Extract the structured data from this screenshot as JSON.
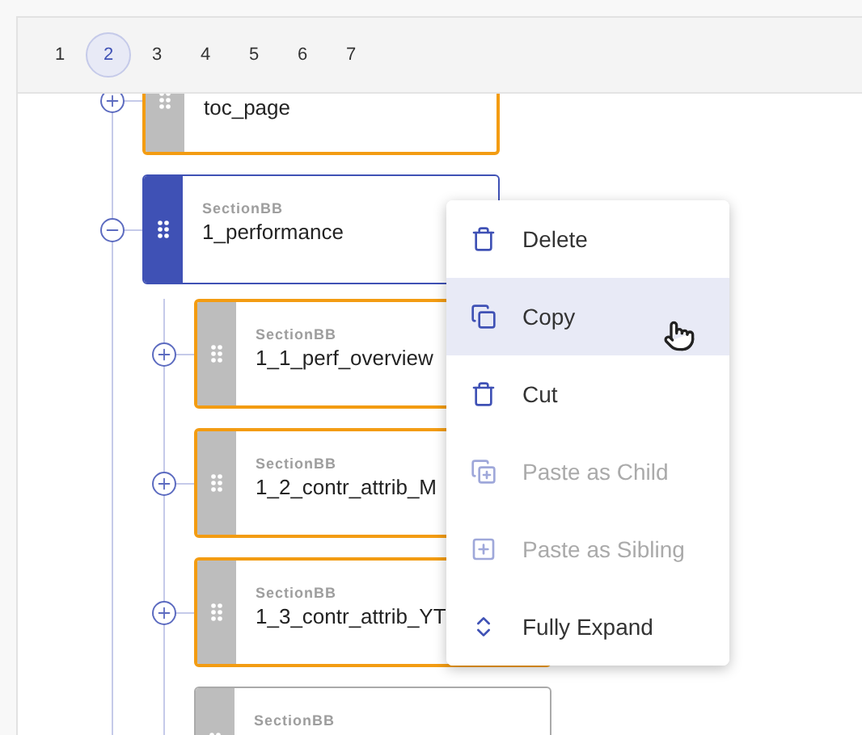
{
  "pager": [
    {
      "label": "1",
      "selected": false
    },
    {
      "label": "2",
      "selected": true
    },
    {
      "label": "3",
      "selected": false
    },
    {
      "label": "4",
      "selected": false
    },
    {
      "label": "5",
      "selected": false
    },
    {
      "label": "6",
      "selected": false
    },
    {
      "label": "7",
      "selected": false
    }
  ],
  "tree": [
    {
      "name": "toc_page",
      "expanded": false,
      "highlighted": true,
      "selected": false
    },
    {
      "type_label": "SectionBB",
      "name": "1_performance",
      "expanded": true,
      "highlighted": false,
      "selected": true,
      "children": [
        {
          "type_label": "SectionBB",
          "name": "1_1_perf_overview",
          "expanded": false,
          "highlighted": true,
          "selected": false
        },
        {
          "type_label": "SectionBB",
          "name": "1_2_contr_attrib_M",
          "expanded": false,
          "highlighted": true,
          "selected": false
        },
        {
          "type_label": "SectionBB",
          "name": "1_3_contr_attrib_YT",
          "expanded": false,
          "highlighted": true,
          "selected": false
        },
        {
          "type_label": "SectionBB",
          "highlighted": false,
          "selected": false
        }
      ]
    }
  ],
  "context_menu": [
    {
      "kind": "delete",
      "label": "Delete",
      "disabled": false,
      "hovered": false
    },
    {
      "kind": "copy",
      "label": "Copy",
      "disabled": false,
      "hovered": true
    },
    {
      "kind": "cut",
      "label": "Cut",
      "disabled": false,
      "hovered": false
    },
    {
      "kind": "paste-child",
      "label": "Paste as Child",
      "disabled": true,
      "hovered": false
    },
    {
      "kind": "paste-sibling",
      "label": "Paste as Sibling",
      "disabled": true,
      "hovered": false
    },
    {
      "kind": "expand",
      "label": "Fully Expand",
      "disabled": false,
      "hovered": false
    }
  ]
}
